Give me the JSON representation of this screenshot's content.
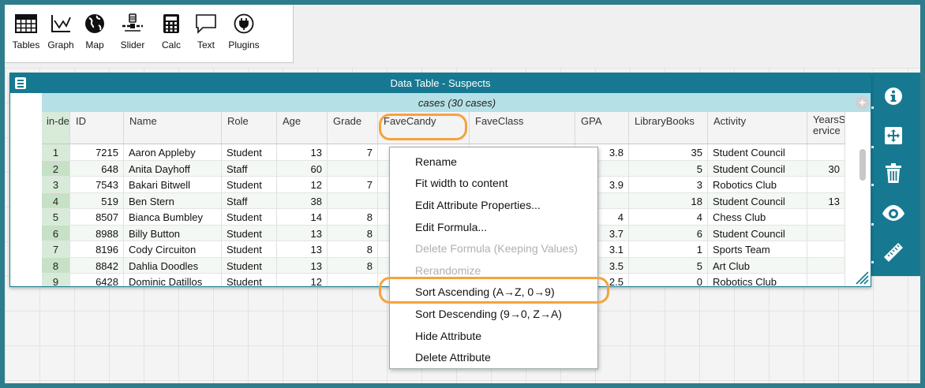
{
  "toolshelf": {
    "tools": [
      {
        "label": "Tables",
        "icon": "tables-icon"
      },
      {
        "label": "Graph",
        "icon": "graph-icon"
      },
      {
        "label": "Map",
        "icon": "map-icon"
      },
      {
        "label": "Slider",
        "icon": "slider-icon"
      },
      {
        "label": "Calc",
        "icon": "calc-icon"
      },
      {
        "label": "Text",
        "icon": "text-icon"
      },
      {
        "label": "Plugins",
        "icon": "plugins-icon"
      }
    ]
  },
  "table": {
    "title": "Data Table - Suspects",
    "cases_label": "cases (30 cases)",
    "add_label": "+",
    "index_header": "in-dex",
    "columns": [
      "ID",
      "Name",
      "Role",
      "Age",
      "Grade",
      "FaveCandy",
      "FaveClass",
      "GPA",
      "LibraryBooks",
      "Activity",
      "YearsService"
    ],
    "column_headers_display": [
      "ID",
      "Name",
      "Role",
      "Age",
      "Grade",
      "FaveCandy",
      "FaveClass",
      "GPA",
      "LibraryBooks",
      "Activity",
      "YearsS ervice"
    ],
    "rows": [
      [
        "1",
        "7215",
        "Aaron Appleby",
        "Student",
        "13",
        "7",
        "",
        "",
        "3.8",
        "35",
        "Student Council",
        ""
      ],
      [
        "2",
        "648",
        "Anita Dayhoff",
        "Staff",
        "60",
        "",
        "",
        "",
        "",
        "5",
        "Student Council",
        "30"
      ],
      [
        "3",
        "7543",
        "Bakari Bitwell",
        "Student",
        "12",
        "7",
        "",
        "",
        "3.9",
        "3",
        "Robotics Club",
        ""
      ],
      [
        "4",
        "519",
        "Ben Stern",
        "Staff",
        "38",
        "",
        "",
        "",
        "",
        "18",
        "Student Council",
        "13"
      ],
      [
        "5",
        "8507",
        "Bianca Bumbley",
        "Student",
        "14",
        "8",
        "",
        "",
        "4",
        "4",
        "Chess Club",
        ""
      ],
      [
        "6",
        "8988",
        "Billy Button",
        "Student",
        "13",
        "8",
        "",
        "",
        "3.7",
        "6",
        "Student Council",
        ""
      ],
      [
        "7",
        "8196",
        "Cody Circuiton",
        "Student",
        "13",
        "8",
        "",
        "",
        "3.1",
        "1",
        "Sports Team",
        ""
      ],
      [
        "8",
        "8842",
        "Dahlia Doodles",
        "Student",
        "13",
        "8",
        "",
        "",
        "3.5",
        "5",
        "Art Club",
        ""
      ],
      [
        "9",
        "6428",
        "Dominic Datillos",
        "Student",
        "12",
        "",
        "",
        "",
        "2.5",
        "0",
        "Robotics Club",
        ""
      ]
    ]
  },
  "context_menu": {
    "items": [
      {
        "label": "Rename",
        "enabled": true
      },
      {
        "label": "Fit width to content",
        "enabled": true
      },
      {
        "label": "Edit Attribute Properties...",
        "enabled": true
      },
      {
        "label": "Edit Formula...",
        "enabled": true
      },
      {
        "label": "Delete Formula (Keeping Values)",
        "enabled": false
      },
      {
        "label": "Rerandomize",
        "enabled": false
      },
      {
        "label": "Sort Ascending (A→Z, 0→9)",
        "enabled": true
      },
      {
        "label": "Sort Descending (9→0, Z→A)",
        "enabled": true
      },
      {
        "label": "Hide Attribute",
        "enabled": true
      },
      {
        "label": "Delete Attribute",
        "enabled": true
      }
    ]
  },
  "palette": {
    "buttons": [
      "info-icon",
      "scale-icon",
      "trash-icon",
      "eye-icon",
      "ruler-icon"
    ]
  },
  "colors": {
    "frame": "#2e7d8c",
    "titlebar": "#177991",
    "cases_bar": "#b5e0e6",
    "index_col": "#d8ead8",
    "highlight": "#f6a23e"
  }
}
